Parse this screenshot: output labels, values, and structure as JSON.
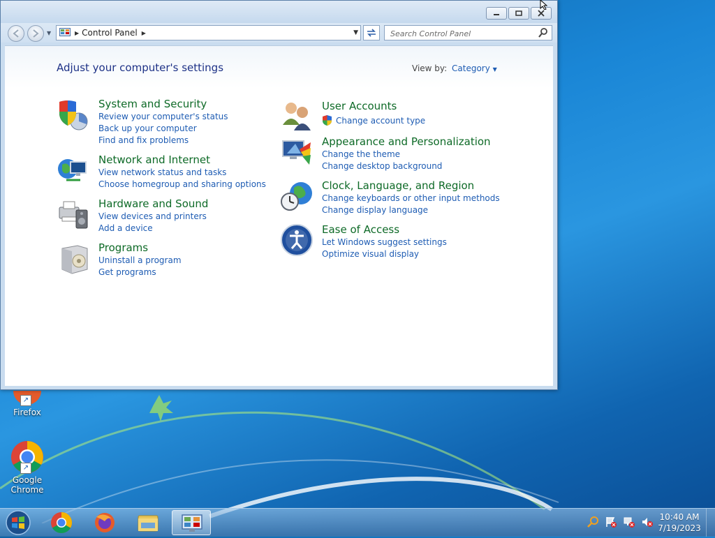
{
  "window": {
    "address": {
      "segments": [
        "Control Panel"
      ],
      "search_placeholder": "Search Control Panel"
    },
    "header": {
      "title": "Adjust your computer's settings",
      "view_by_label": "View by:",
      "view_by_value": "Category"
    },
    "categories_left": [
      {
        "title": "System and Security",
        "links": [
          "Review your computer's status",
          "Back up your computer",
          "Find and fix problems"
        ]
      },
      {
        "title": "Network and Internet",
        "links": [
          "View network status and tasks",
          "Choose homegroup and sharing options"
        ]
      },
      {
        "title": "Hardware and Sound",
        "links": [
          "View devices and printers",
          "Add a device"
        ]
      },
      {
        "title": "Programs",
        "links": [
          "Uninstall a program",
          "Get programs"
        ]
      }
    ],
    "categories_right": [
      {
        "title": "User Accounts",
        "links": [
          "Change account type"
        ]
      },
      {
        "title": "Appearance and Personalization",
        "links": [
          "Change the theme",
          "Change desktop background"
        ]
      },
      {
        "title": "Clock, Language, and Region",
        "links": [
          "Change keyboards or other input methods",
          "Change display language"
        ]
      },
      {
        "title": "Ease of Access",
        "links": [
          "Let Windows suggest settings",
          "Optimize visual display"
        ]
      }
    ]
  },
  "desktop": {
    "icons": [
      {
        "label": "Firefox"
      },
      {
        "label": "Google Chrome"
      }
    ]
  },
  "taskbar": {
    "clock_time": "10:40 AM",
    "clock_date": "7/19/2023"
  }
}
